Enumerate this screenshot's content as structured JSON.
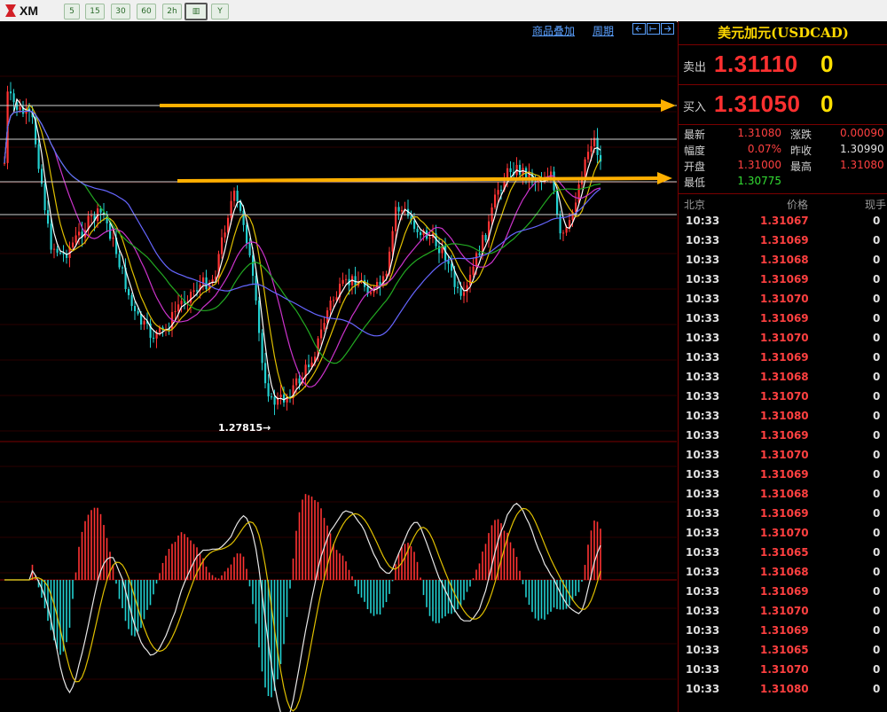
{
  "toolbar": {
    "logo_text": "XM",
    "buttons": [
      "5",
      "15",
      "30",
      "60",
      "2h",
      "",
      ""
    ],
    "selected_index": 5
  },
  "chart": {
    "overlay_label": "商品叠加",
    "period_label": "周期",
    "low_marker": "1.27815",
    "colors": {
      "up": "#ff3333",
      "down": "#22d0d0",
      "ma1": "#ffffff",
      "ma2": "#e0c000",
      "ma3": "#cc33cc",
      "ma4": "#22aa22",
      "ma5": "#6666ff",
      "arrow": "#ffb000"
    }
  },
  "chart_data": {
    "type": "candlestick",
    "price_range": [
      1.275,
      1.318
    ],
    "low": 1.27815,
    "annotated_levels": [
      1.3105,
      1.3082
    ]
  },
  "panel": {
    "title": "美元加元(USDCAD)",
    "sell": {
      "label": "卖出",
      "price": "1.31110",
      "volume": "0"
    },
    "buy": {
      "label": "买入",
      "price": "1.31050",
      "volume": "0"
    },
    "stats": [
      {
        "label": "最新",
        "value": "1.31080",
        "label2": "涨跌",
        "value2": "0.00090"
      },
      {
        "label": "幅度",
        "value": "0.07%",
        "label2": "昨收",
        "value2": "1.30990"
      },
      {
        "label": "开盘",
        "value": "1.31000",
        "label2": "最高",
        "value2": "1.31080"
      },
      {
        "label": "最低",
        "value": "1.30775",
        "label2": "",
        "value2": ""
      }
    ],
    "table_headers": {
      "time": "北京",
      "price": "价格",
      "volume": "现手"
    },
    "ticks": [
      {
        "time": "10:33",
        "price": "1.31067",
        "vol": "0"
      },
      {
        "time": "10:33",
        "price": "1.31069",
        "vol": "0"
      },
      {
        "time": "10:33",
        "price": "1.31068",
        "vol": "0"
      },
      {
        "time": "10:33",
        "price": "1.31069",
        "vol": "0"
      },
      {
        "time": "10:33",
        "price": "1.31070",
        "vol": "0"
      },
      {
        "time": "10:33",
        "price": "1.31069",
        "vol": "0"
      },
      {
        "time": "10:33",
        "price": "1.31070",
        "vol": "0"
      },
      {
        "time": "10:33",
        "price": "1.31069",
        "vol": "0"
      },
      {
        "time": "10:33",
        "price": "1.31068",
        "vol": "0"
      },
      {
        "time": "10:33",
        "price": "1.31070",
        "vol": "0"
      },
      {
        "time": "10:33",
        "price": "1.31080",
        "vol": "0"
      },
      {
        "time": "10:33",
        "price": "1.31069",
        "vol": "0"
      },
      {
        "time": "10:33",
        "price": "1.31070",
        "vol": "0"
      },
      {
        "time": "10:33",
        "price": "1.31069",
        "vol": "0"
      },
      {
        "time": "10:33",
        "price": "1.31068",
        "vol": "0"
      },
      {
        "time": "10:33",
        "price": "1.31069",
        "vol": "0"
      },
      {
        "time": "10:33",
        "price": "1.31070",
        "vol": "0"
      },
      {
        "time": "10:33",
        "price": "1.31065",
        "vol": "0"
      },
      {
        "time": "10:33",
        "price": "1.31068",
        "vol": "0"
      },
      {
        "time": "10:33",
        "price": "1.31069",
        "vol": "0"
      },
      {
        "time": "10:33",
        "price": "1.31070",
        "vol": "0"
      },
      {
        "time": "10:33",
        "price": "1.31069",
        "vol": "0"
      },
      {
        "time": "10:33",
        "price": "1.31065",
        "vol": "0"
      },
      {
        "time": "10:33",
        "price": "1.31070",
        "vol": "0"
      },
      {
        "time": "10:33",
        "price": "1.31080",
        "vol": "0"
      }
    ]
  }
}
